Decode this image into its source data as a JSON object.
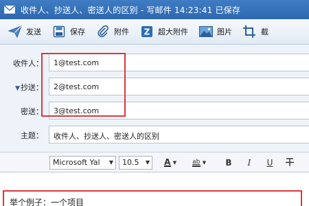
{
  "window": {
    "title": "收件人、抄送人、密送人的区别 - 写邮件   14:23:41 已保存"
  },
  "toolbar": {
    "send_label": "发送",
    "save_label": "保存",
    "attach_label": "附件",
    "large_attach_label": "超大附件",
    "image_label": "图片",
    "screenshot_label": "截"
  },
  "fields": {
    "to_label": "收件人：",
    "to_value": "1@test.com",
    "cc_label": "抄送：",
    "cc_value": "2@test.com",
    "bcc_label": "密送：",
    "bcc_value": "3@test.com",
    "subject_label": "主题：",
    "subject_value": "收件人、抄送人、密送人的区别"
  },
  "format": {
    "font_family": "Microsoft Yal",
    "font_size": "10.5"
  },
  "body": {
    "text": "举个例子：一个项目"
  },
  "colors": {
    "titlebar": "#2d68b0",
    "highlight": "#d9383a"
  }
}
